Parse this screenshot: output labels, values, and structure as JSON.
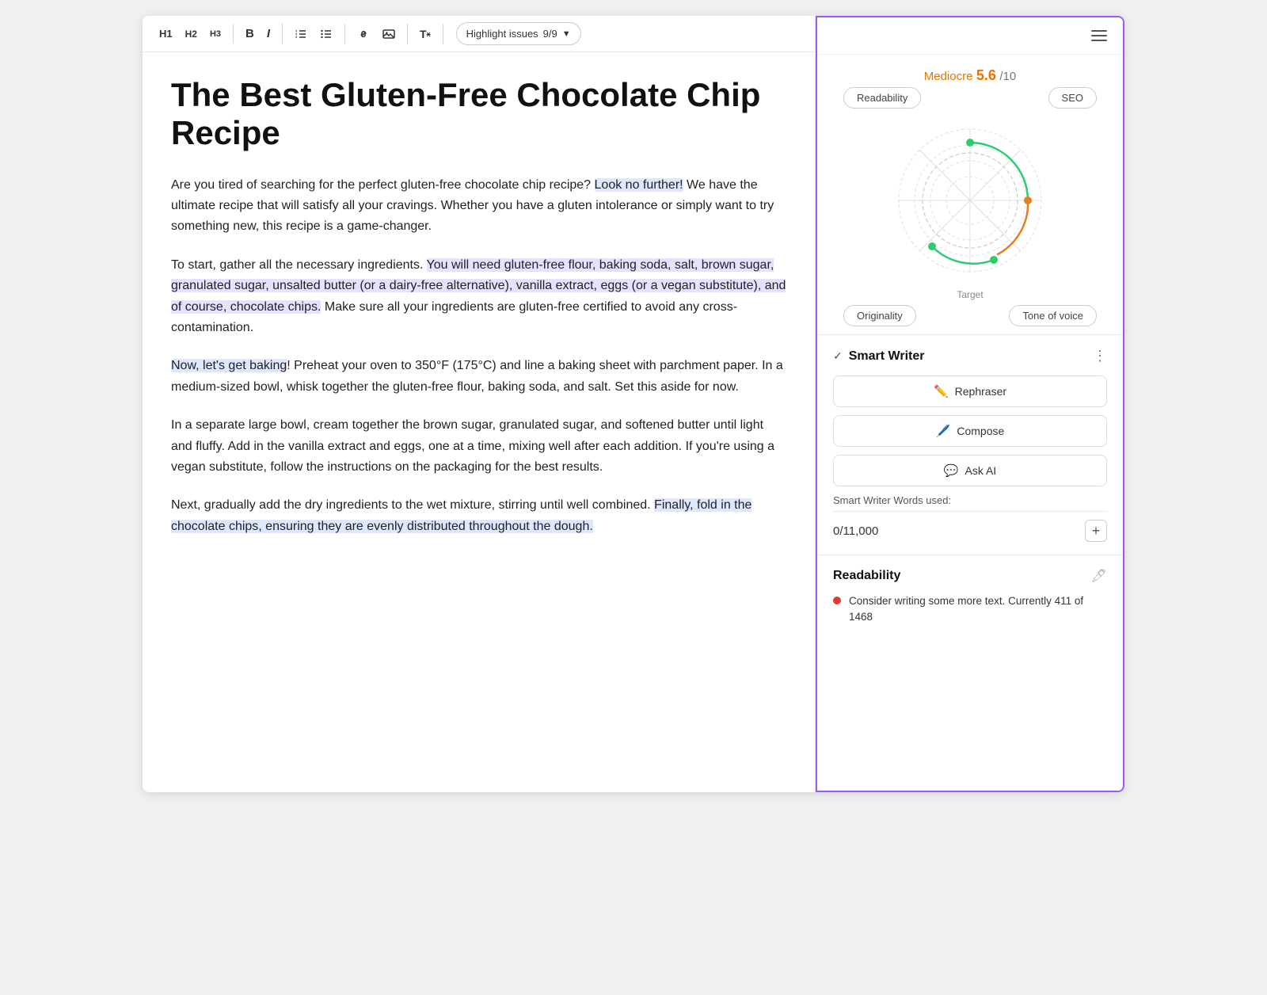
{
  "toolbar": {
    "h1": "H1",
    "h2": "H2",
    "h3": "H3",
    "highlight_label": "Highlight issues",
    "highlight_count": "9/9"
  },
  "editor": {
    "title": "The Best Gluten-Free Chocolate Chip Recipe",
    "paragraphs": [
      {
        "id": "p1",
        "segments": [
          {
            "text": "Are you tired of searching for the perfect gluten-free chocolate chip recipe? ",
            "highlight": "none"
          },
          {
            "text": "Look no further!",
            "highlight": "blue"
          },
          {
            "text": " We have the ultimate recipe that will satisfy all your cravings. Whether you have a gluten intolerance or simply want to try something new, this recipe is a game-changer.",
            "highlight": "none"
          }
        ]
      },
      {
        "id": "p2",
        "segments": [
          {
            "text": "To start, gather all the necessary ingredients. ",
            "highlight": "none"
          },
          {
            "text": "You will need gluten-free flour, baking soda, salt, brown sugar, granulated sugar, unsalted butter (or a dairy-free alternative), vanilla extract, eggs (or a vegan substitute), and of course, chocolate chips.",
            "highlight": "purple"
          },
          {
            "text": " Make sure all your ingredients are gluten-free certified to avoid any cross-contamination.",
            "highlight": "none"
          }
        ]
      },
      {
        "id": "p3",
        "segments": [
          {
            "text": "Now, let's get baking",
            "highlight": "blue"
          },
          {
            "text": "! Preheat your oven to 350°F (175°C) and line a baking sheet with parchment paper. In a medium-sized bowl, whisk together the gluten-free flour, baking soda, and salt. Set this aside for now.",
            "highlight": "none"
          }
        ]
      },
      {
        "id": "p4",
        "segments": [
          {
            "text": "In a separate large bowl, cream together the brown sugar, granulated sugar, and softened butter until light and fluffy. Add in the vanilla extract and eggs, one at a time, mixing well after each addition. If you're using a vegan substitute, follow the instructions on the packaging for the best results.",
            "highlight": "none"
          }
        ]
      },
      {
        "id": "p5",
        "segments": [
          {
            "text": "Next, gradually add the dry ingredients to the wet mixture, stirring until well combined. ",
            "highlight": "none"
          },
          {
            "text": "Finally, fold in the chocolate chips, ensuring they are evenly distributed throughout the dough.",
            "highlight": "blue"
          },
          {
            "text": "",
            "highlight": "none"
          }
        ]
      }
    ]
  },
  "right_panel": {
    "menu_icon_label": "menu",
    "score_label": "Mediocre",
    "score_value": "5.6",
    "score_max": "/10",
    "tabs": {
      "readability": "Readability",
      "seo": "SEO",
      "originality": "Originality",
      "tone_of_voice": "Tone of voice"
    },
    "radar": {
      "target_label": "Target"
    },
    "smart_writer": {
      "title": "Smart Writer",
      "rephraser": "Rephraser",
      "compose": "Compose",
      "ask_ai": "Ask AI",
      "words_label": "Smart Writer Words used:",
      "words_used": "0",
      "words_total": "11,000"
    },
    "readability": {
      "title": "Readability",
      "item": "Consider writing some more text. Currently 411 of 1468"
    }
  }
}
